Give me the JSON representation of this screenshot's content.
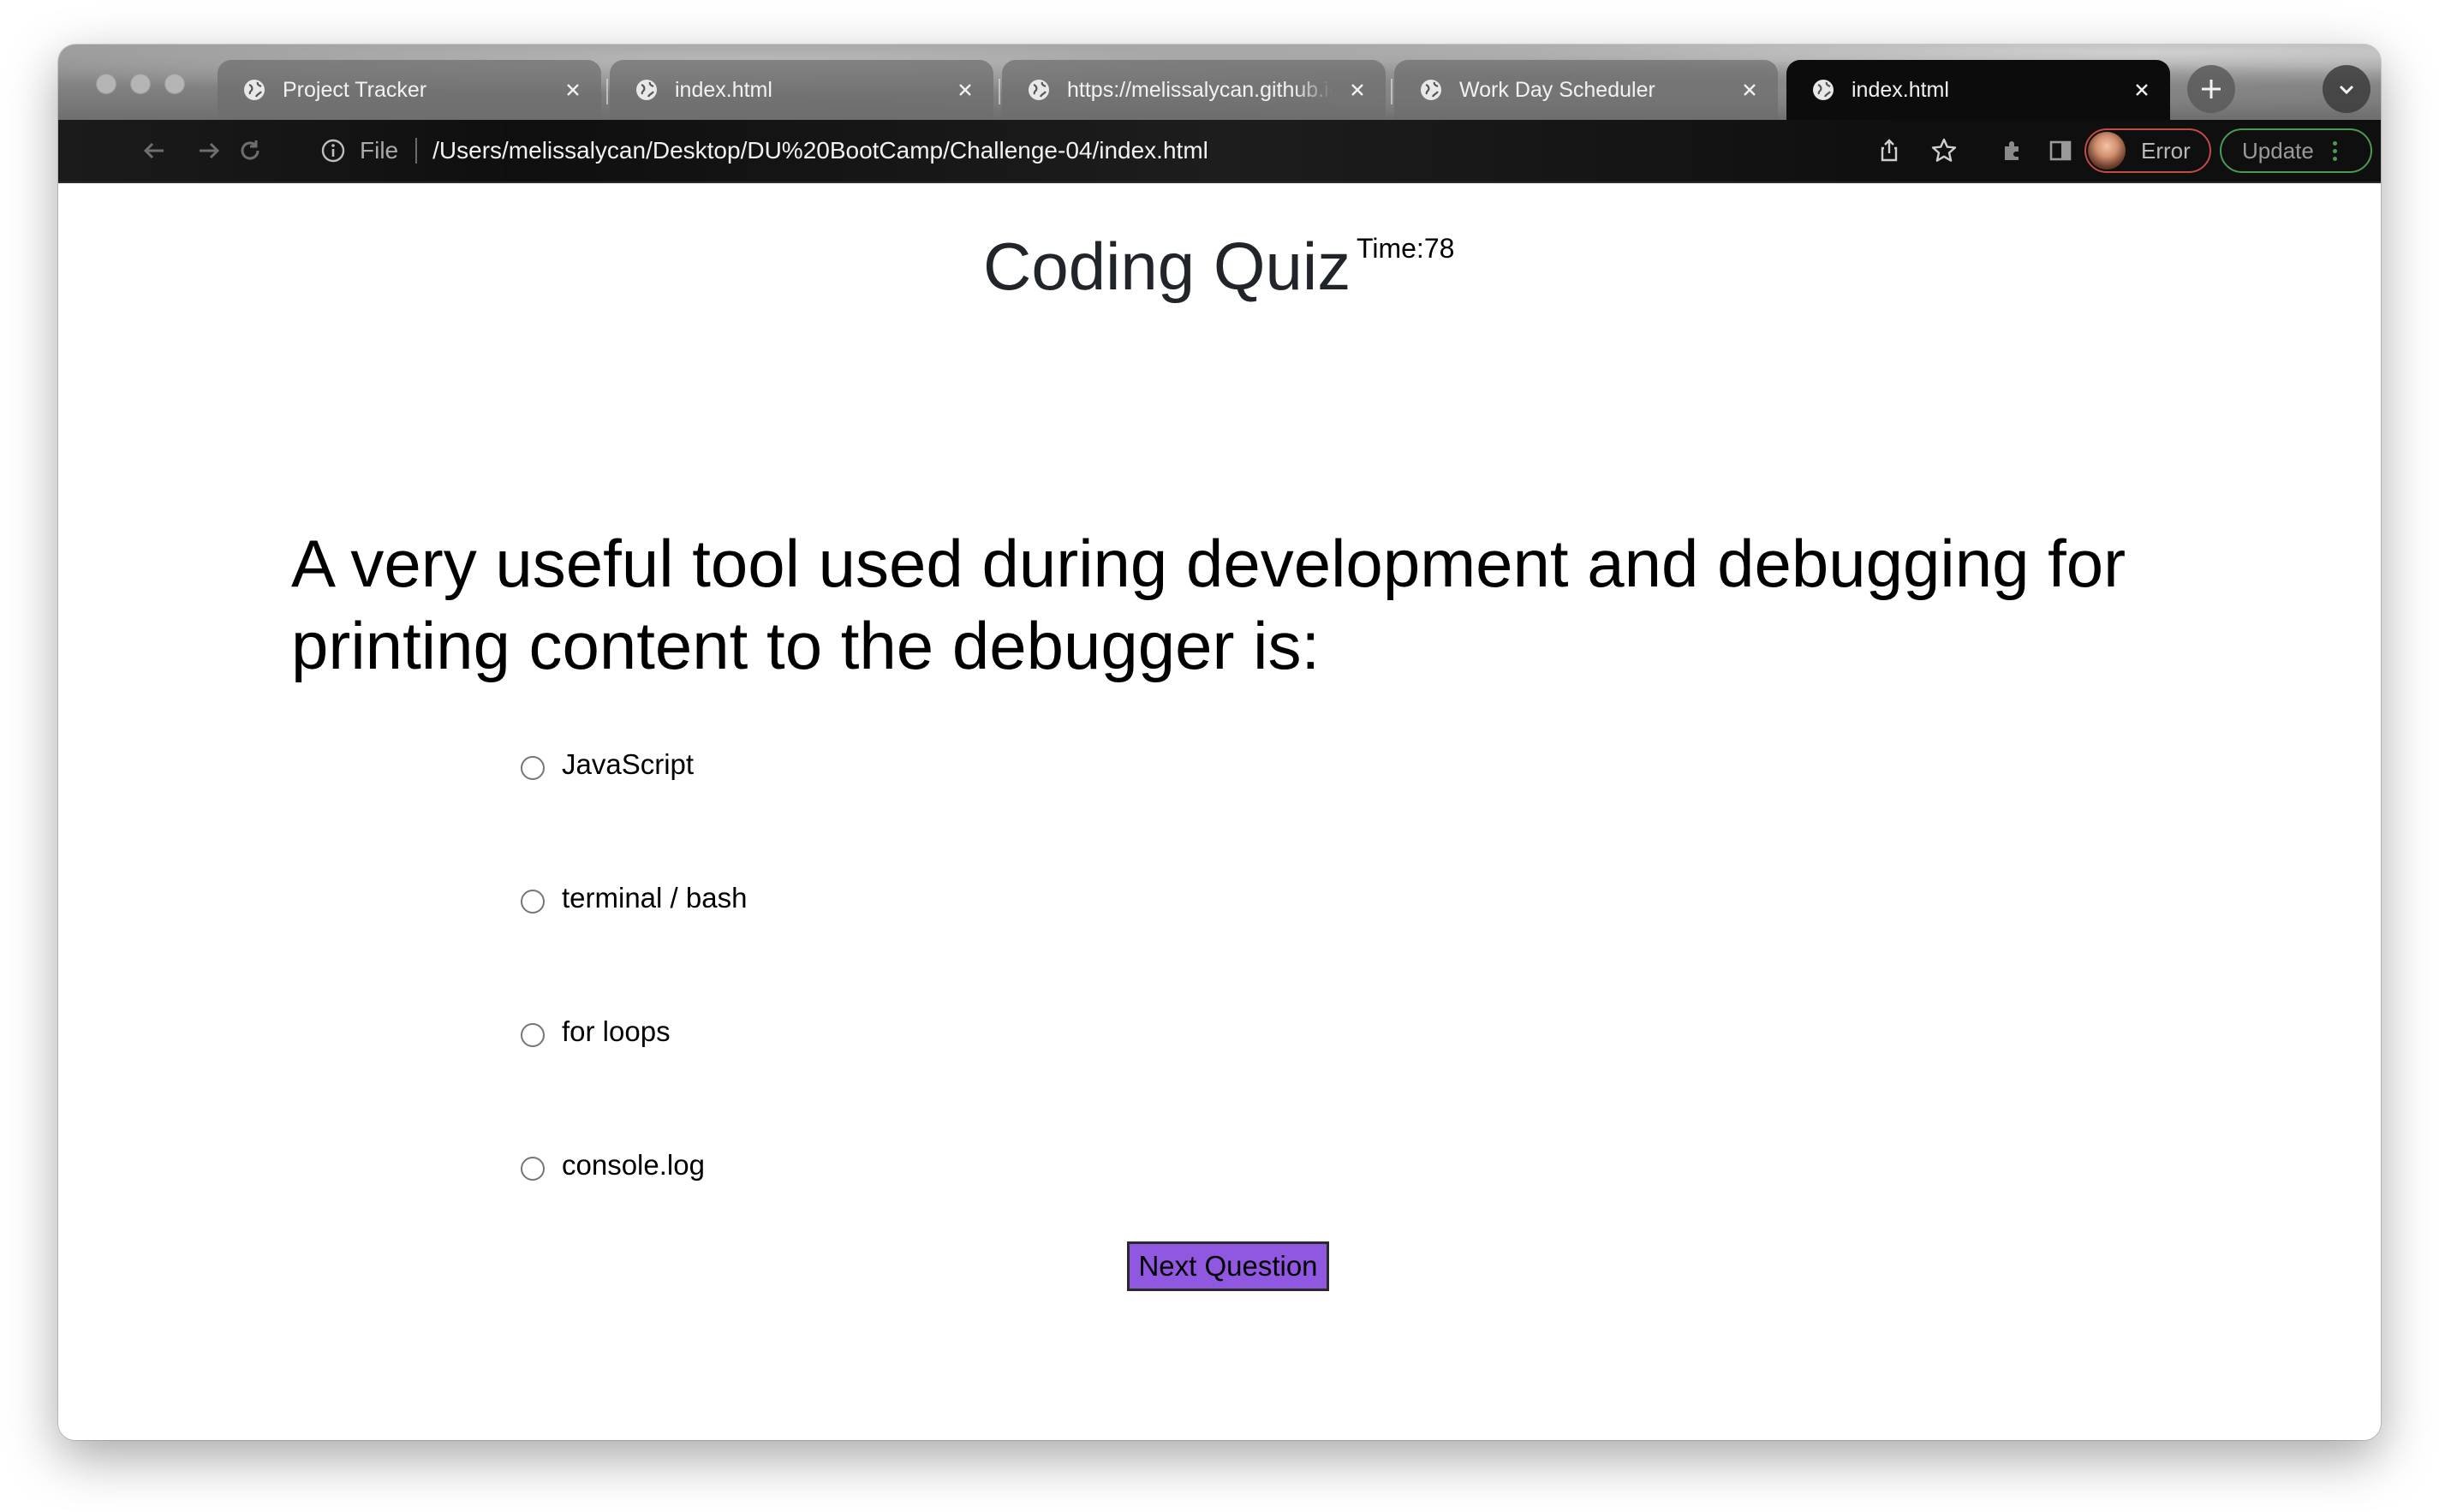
{
  "browser": {
    "tabs": [
      {
        "title": "Project Tracker",
        "active": false
      },
      {
        "title": "index.html",
        "active": false
      },
      {
        "title": "https://melissalycan.github.io",
        "active": false
      },
      {
        "title": "Work Day Scheduler",
        "active": false
      },
      {
        "title": "index.html",
        "active": true
      }
    ],
    "omnibox": {
      "scheme_label": "File",
      "url": "/Users/melissalycan/Desktop/DU%20BootCamp/Challenge-04/index.html"
    },
    "profile": {
      "status_label": "Error"
    },
    "update": {
      "label": "Update"
    },
    "colors": {
      "update_accent": "#4c9a56",
      "error_accent": "#c24b43"
    }
  },
  "page": {
    "title": "Coding Quiz",
    "timer": "Time:78",
    "question": "A very useful tool used during development and debugging for printing content to the debugger is:",
    "answers": [
      {
        "label": "JavaScript",
        "selected": false
      },
      {
        "label": "terminal / bash",
        "selected": false
      },
      {
        "label": "for loops",
        "selected": false
      },
      {
        "label": "console.log",
        "selected": false
      }
    ],
    "next_button_label": "Next Question",
    "colors": {
      "button_bg": "#9058e0"
    }
  }
}
